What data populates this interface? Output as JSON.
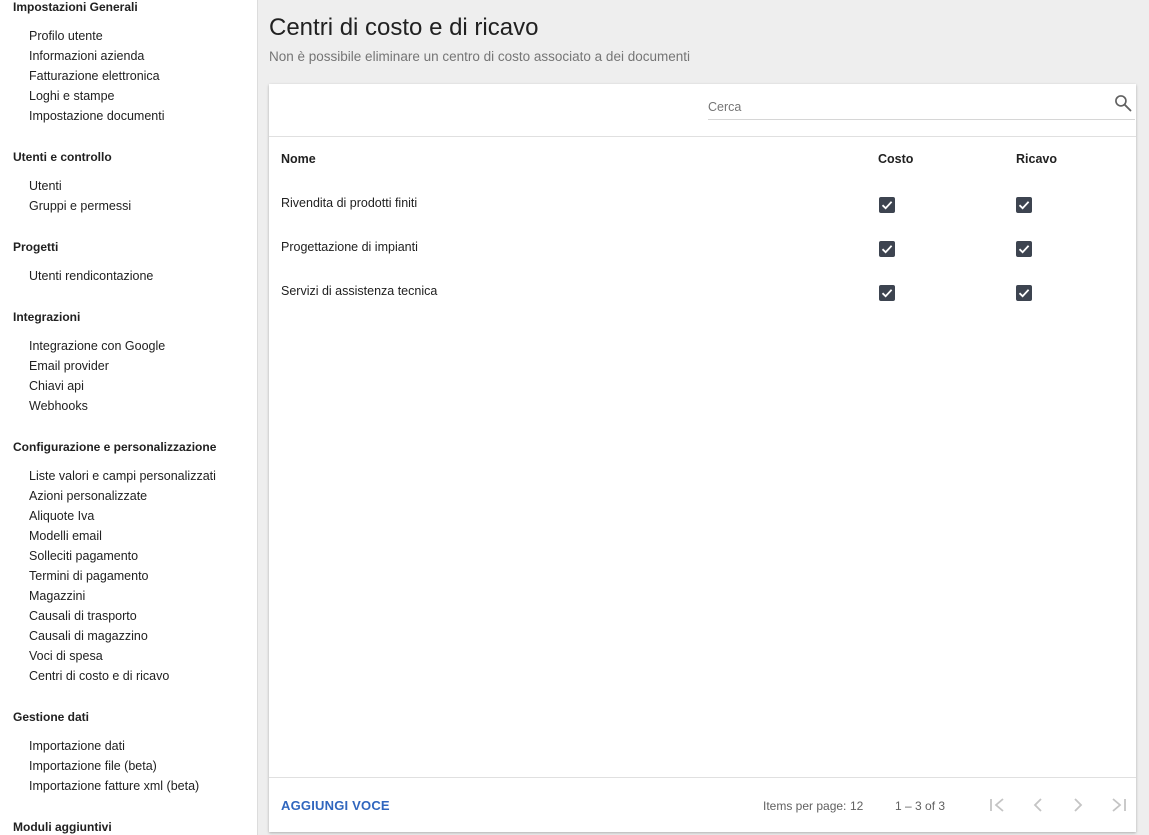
{
  "sidebar": {
    "sections": [
      {
        "title": "Impostazioni Generali",
        "items": [
          "Profilo utente",
          "Informazioni azienda",
          "Fatturazione elettronica",
          "Loghi e stampe",
          "Impostazione documenti"
        ]
      },
      {
        "title": "Utenti e controllo",
        "items": [
          "Utenti",
          "Gruppi e permessi"
        ]
      },
      {
        "title": "Progetti",
        "items": [
          "Utenti rendicontazione"
        ]
      },
      {
        "title": "Integrazioni",
        "items": [
          "Integrazione con Google",
          "Email provider",
          "Chiavi api",
          "Webhooks"
        ]
      },
      {
        "title": "Configurazione e personalizzazione",
        "items": [
          "Liste valori e campi personalizzati",
          "Azioni personalizzate",
          "Aliquote Iva",
          "Modelli email",
          "Solleciti pagamento",
          "Termini di pagamento",
          "Magazzini",
          "Causali di trasporto",
          "Causali di magazzino",
          "Voci di spesa",
          "Centri di costo e di ricavo"
        ]
      },
      {
        "title": "Gestione dati",
        "items": [
          "Importazione dati",
          "Importazione file (beta)",
          "Importazione fatture xml (beta)"
        ]
      },
      {
        "title": "Moduli aggiuntivi",
        "items": []
      }
    ]
  },
  "header": {
    "title": "Centri di costo e di ricavo",
    "subtitle": "Non è possibile eliminare un centro di costo associato a dei documenti"
  },
  "search": {
    "placeholder": "Cerca",
    "value": "",
    "icon": "search-icon"
  },
  "table": {
    "columns": {
      "name": "Nome",
      "cost": "Costo",
      "revenue": "Ricavo"
    },
    "rows": [
      {
        "name": "Rivendita di prodotti finiti",
        "cost": true,
        "revenue": true
      },
      {
        "name": "Progettazione di impianti",
        "cost": true,
        "revenue": true
      },
      {
        "name": "Servizi di assistenza tecnica",
        "cost": true,
        "revenue": true
      }
    ]
  },
  "footer": {
    "add_label": "AGGIUNGI VOCE",
    "items_per_page_label": "Items per page:",
    "items_per_page_value": "12",
    "range": "1 – 3 of 3",
    "pagination_icons": [
      "first-page-icon",
      "previous-page-icon",
      "next-page-icon",
      "last-page-icon"
    ]
  },
  "colors": {
    "accent": "#3066be",
    "checkbox": "#3d4450",
    "background": "#eeeeee",
    "muted_text": "#757575"
  }
}
